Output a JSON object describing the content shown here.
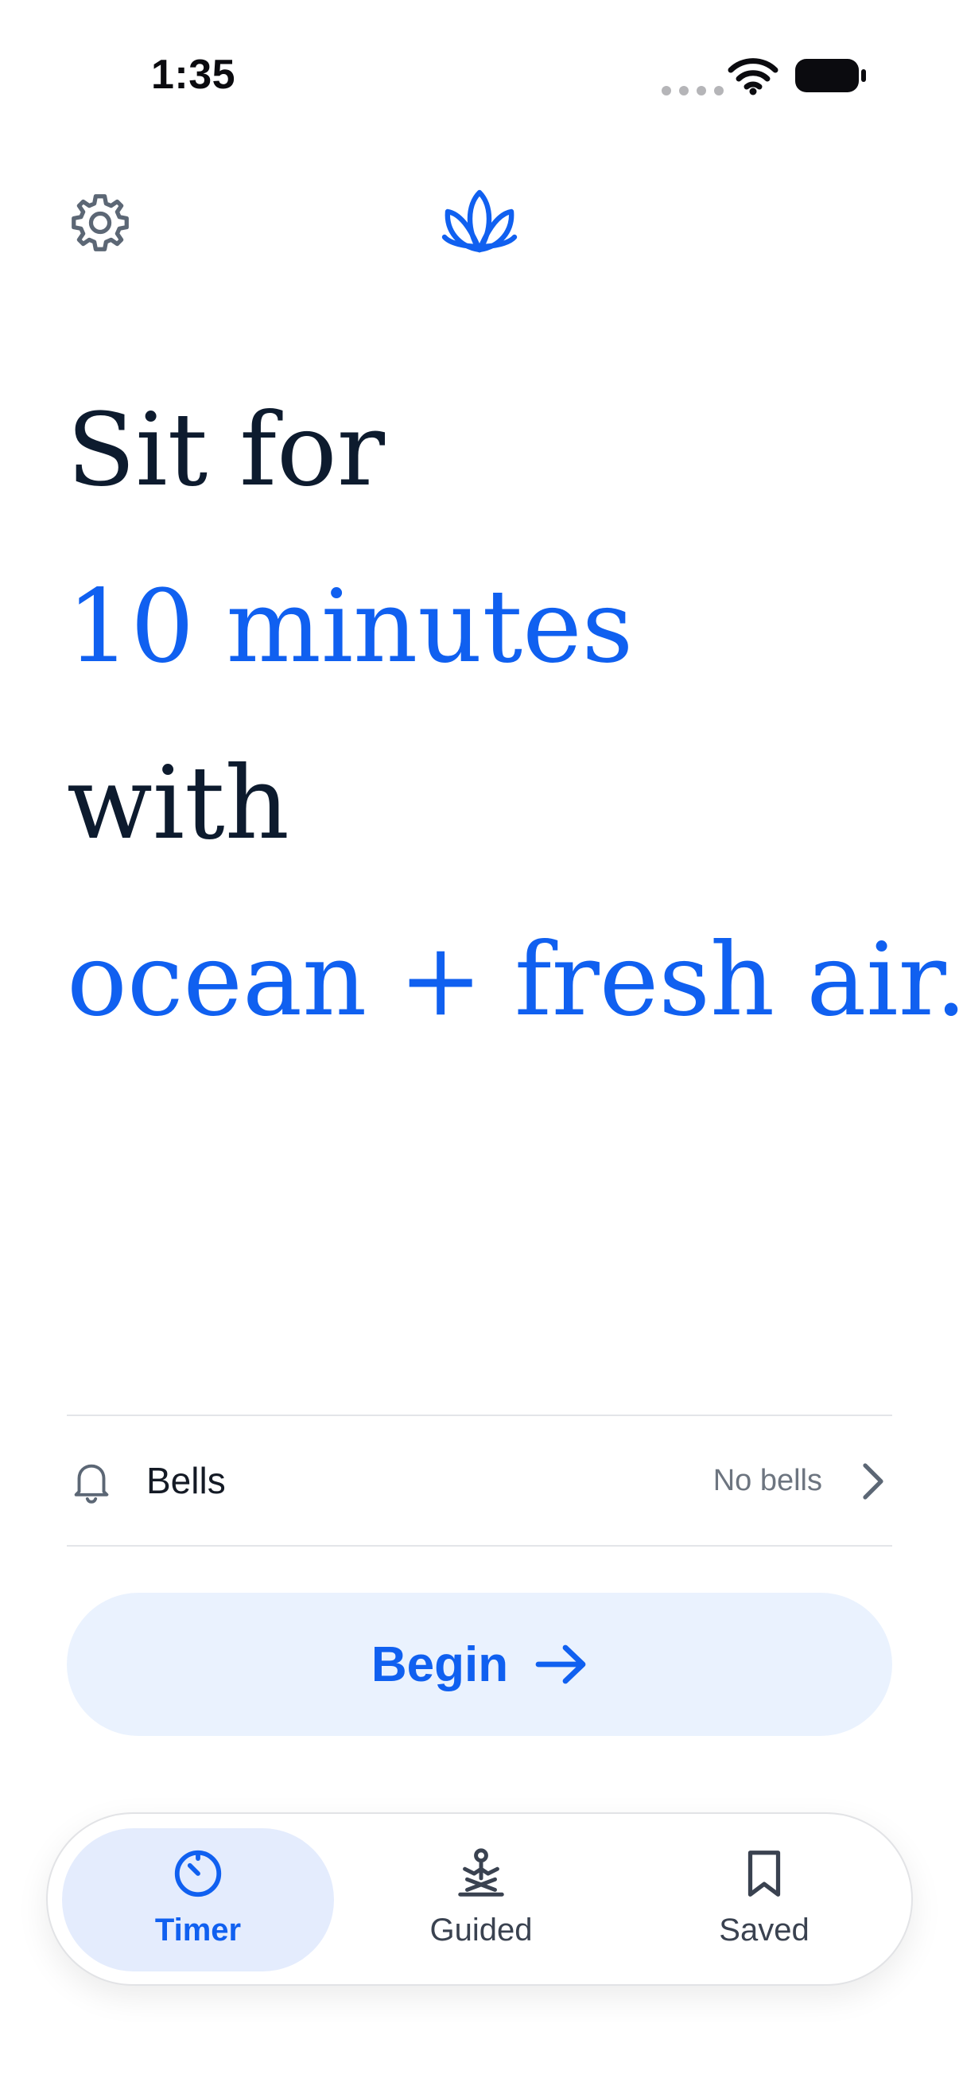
{
  "status_bar": {
    "time": "1:35"
  },
  "header": {
    "settings_icon": "gear-icon",
    "logo_icon": "lotus-icon"
  },
  "headline": {
    "line1": "Sit for",
    "line2": "10 minutes",
    "line3": "with",
    "line4": "ocean + fresh air."
  },
  "bells": {
    "label": "Bells",
    "value": "No bells"
  },
  "begin": {
    "label": "Begin"
  },
  "tabs": [
    {
      "label": "Timer",
      "icon": "timer-icon",
      "active": true
    },
    {
      "label": "Guided",
      "icon": "meditation-icon",
      "active": false
    },
    {
      "label": "Saved",
      "icon": "bookmark-icon",
      "active": false
    }
  ],
  "colors": {
    "accent": "#1060f0",
    "text_dark": "#0d1b2e",
    "button_bg": "#eaf2fe",
    "tab_active_bg": "#e4ecfd"
  }
}
